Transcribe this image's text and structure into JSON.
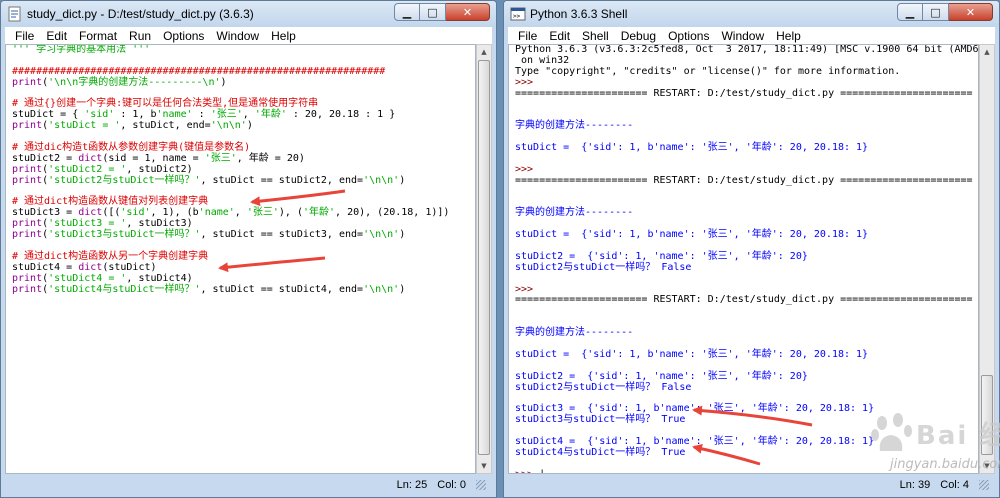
{
  "editor": {
    "title": "study_dict.py - D:/test/study_dict.py (3.6.3)",
    "menu": [
      "File",
      "Edit",
      "Format",
      "Run",
      "Options",
      "Window",
      "Help"
    ],
    "status": {
      "line": "Ln: 25",
      "col": "Col: 0"
    },
    "scroll_position": 0.0,
    "lines": [
      [
        [
          "str",
          "''' 学习字典的基本用法 '''"
        ]
      ],
      [],
      [
        [
          "cmt",
          "##############################################################"
        ]
      ],
      [
        [
          "bi",
          "print"
        ],
        [
          "def",
          "("
        ],
        [
          "str",
          "'\\n\\n字典的创建方法---------\\n'"
        ],
        [
          "def",
          ")"
        ]
      ],
      [],
      [
        [
          "cmt",
          "# 通过{}创建一个字典:键可以是任何合法类型,但是通常使用字符串"
        ]
      ],
      [
        [
          "def",
          "stuDict = { "
        ],
        [
          "str",
          "'sid'"
        ],
        [
          "def",
          " : 1, b"
        ],
        [
          "str",
          "'name'"
        ],
        [
          "def",
          " : "
        ],
        [
          "str",
          "'张三'"
        ],
        [
          "def",
          ", "
        ],
        [
          "str",
          "'年龄'"
        ],
        [
          "def",
          " : 20, 20.18 : 1 }"
        ]
      ],
      [
        [
          "bi",
          "print"
        ],
        [
          "def",
          "("
        ],
        [
          "str",
          "'stuDict = '"
        ],
        [
          "def",
          ", stuDict, end="
        ],
        [
          "str",
          "'\\n\\n'"
        ],
        [
          "def",
          ")"
        ]
      ],
      [],
      [
        [
          "cmt",
          "# 通过dic构造t函数从参数创建字典(键值是参数名)"
        ]
      ],
      [
        [
          "def",
          "stuDict2 = "
        ],
        [
          "bi",
          "dict"
        ],
        [
          "def",
          "(sid = 1, name = "
        ],
        [
          "str",
          "'张三'"
        ],
        [
          "def",
          ", 年龄 = 20)"
        ]
      ],
      [
        [
          "bi",
          "print"
        ],
        [
          "def",
          "("
        ],
        [
          "str",
          "'stuDict2 = '"
        ],
        [
          "def",
          ", stuDict2)"
        ]
      ],
      [
        [
          "bi",
          "print"
        ],
        [
          "def",
          "("
        ],
        [
          "str",
          "'stuDict2与stuDict一样吗？'"
        ],
        [
          "def",
          ", stuDict == stuDict2, end="
        ],
        [
          "str",
          "'\\n\\n'"
        ],
        [
          "def",
          ")"
        ]
      ],
      [],
      [
        [
          "cmt",
          "# 通过dict构造函数从键值对列表创建字典"
        ]
      ],
      [
        [
          "def",
          "stuDict3 = "
        ],
        [
          "bi",
          "dict"
        ],
        [
          "def",
          "([("
        ],
        [
          "str",
          "'sid'"
        ],
        [
          "def",
          ", 1), (b"
        ],
        [
          "str",
          "'name'"
        ],
        [
          "def",
          ", "
        ],
        [
          "str",
          "'张三'"
        ],
        [
          "def",
          "), ("
        ],
        [
          "str",
          "'年龄'"
        ],
        [
          "def",
          ", 20), (20.18, 1)])"
        ]
      ],
      [
        [
          "bi",
          "print"
        ],
        [
          "def",
          "("
        ],
        [
          "str",
          "'stuDict3 = '"
        ],
        [
          "def",
          ", stuDict3)"
        ]
      ],
      [
        [
          "bi",
          "print"
        ],
        [
          "def",
          "("
        ],
        [
          "str",
          "'stuDict3与stuDict一样吗？'"
        ],
        [
          "def",
          ", stuDict == stuDict3, end="
        ],
        [
          "str",
          "'\\n\\n'"
        ],
        [
          "def",
          ")"
        ]
      ],
      [],
      [
        [
          "cmt",
          "# 通过dict构造函数从另一个字典创建字典"
        ]
      ],
      [
        [
          "def",
          "stuDict4 = "
        ],
        [
          "bi",
          "dict"
        ],
        [
          "def",
          "(stuDict)"
        ]
      ],
      [
        [
          "bi",
          "print"
        ],
        [
          "def",
          "("
        ],
        [
          "str",
          "'stuDict4 = '"
        ],
        [
          "def",
          ", stuDict4)"
        ]
      ],
      [
        [
          "bi",
          "print"
        ],
        [
          "def",
          "("
        ],
        [
          "str",
          "'stuDict4与stuDict一样吗？'"
        ],
        [
          "def",
          ", stuDict == stuDict4, end="
        ],
        [
          "str",
          "'\\n\\n'"
        ],
        [
          "def",
          ")"
        ]
      ]
    ]
  },
  "shell": {
    "title": "Python 3.6.3 Shell",
    "menu": [
      "File",
      "Edit",
      "Shell",
      "Debug",
      "Options",
      "Window",
      "Help"
    ],
    "status": {
      "line": "Ln: 39",
      "col": "Col: 4"
    },
    "scroll_position": 1.0,
    "lines": [
      [
        [
          "def",
          "Python 3.6.3 (v3.6.3:2c5fed8, Oct  3 2017, 18:11:49) [MSC v.1900 64 bit (AMD64)]"
        ]
      ],
      [
        [
          "def",
          " on win32"
        ]
      ],
      [
        [
          "def",
          "Type \"copyright\", \"credits\" or \"license()\" for more information."
        ]
      ],
      [
        [
          "prm",
          ">>> "
        ]
      ],
      [
        [
          "def",
          "====================== RESTART: D:/test/study_dict.py ======================"
        ]
      ],
      [],
      [],
      [
        [
          "out",
          "字典的创建方法--------"
        ]
      ],
      [],
      [
        [
          "out",
          "stuDict =  {'sid': 1, b'name': '张三', '年龄': 20, 20.18: 1}"
        ]
      ],
      [],
      [
        [
          "prm",
          ">>> "
        ]
      ],
      [
        [
          "def",
          "====================== RESTART: D:/test/study_dict.py ======================"
        ]
      ],
      [],
      [],
      [
        [
          "out",
          "字典的创建方法--------"
        ]
      ],
      [],
      [
        [
          "out",
          "stuDict =  {'sid': 1, b'name': '张三', '年龄': 20, 20.18: 1}"
        ]
      ],
      [],
      [
        [
          "out",
          "stuDict2 =  {'sid': 1, 'name': '张三', '年龄': 20}"
        ]
      ],
      [
        [
          "out",
          "stuDict2与stuDict一样吗？ False"
        ]
      ],
      [],
      [
        [
          "prm",
          ">>> "
        ]
      ],
      [
        [
          "def",
          "====================== RESTART: D:/test/study_dict.py ======================"
        ]
      ],
      [],
      [],
      [
        [
          "out",
          "字典的创建方法--------"
        ]
      ],
      [],
      [
        [
          "out",
          "stuDict =  {'sid': 1, b'name': '张三', '年龄': 20, 20.18: 1}"
        ]
      ],
      [],
      [
        [
          "out",
          "stuDict2 =  {'sid': 1, 'name': '张三', '年龄': 20}"
        ]
      ],
      [
        [
          "out",
          "stuDict2与stuDict一样吗？ False"
        ]
      ],
      [],
      [
        [
          "out",
          "stuDict3 =  {'sid': 1, b'name': '张三', '年龄': 20, 20.18: 1}"
        ]
      ],
      [
        [
          "out",
          "stuDict3与stuDict一样吗？ True"
        ]
      ],
      [],
      [
        [
          "out",
          "stuDict4 =  {'sid': 1, b'name': '张三', '年龄': 20, 20.18: 1}"
        ]
      ],
      [
        [
          "out",
          "stuDict4与stuDict一样吗？ True"
        ]
      ],
      [],
      [
        [
          "prm",
          ">>> "
        ],
        [
          "def",
          "|"
        ]
      ]
    ]
  },
  "watermark": {
    "main": "Bai 经验",
    "url": "jingyan.baidu.com"
  },
  "colors": {
    "string": "#00aa00",
    "comment": "#dd0000",
    "builtin": "#900090",
    "output": "#0000ff",
    "arrow": "#e8443a"
  }
}
